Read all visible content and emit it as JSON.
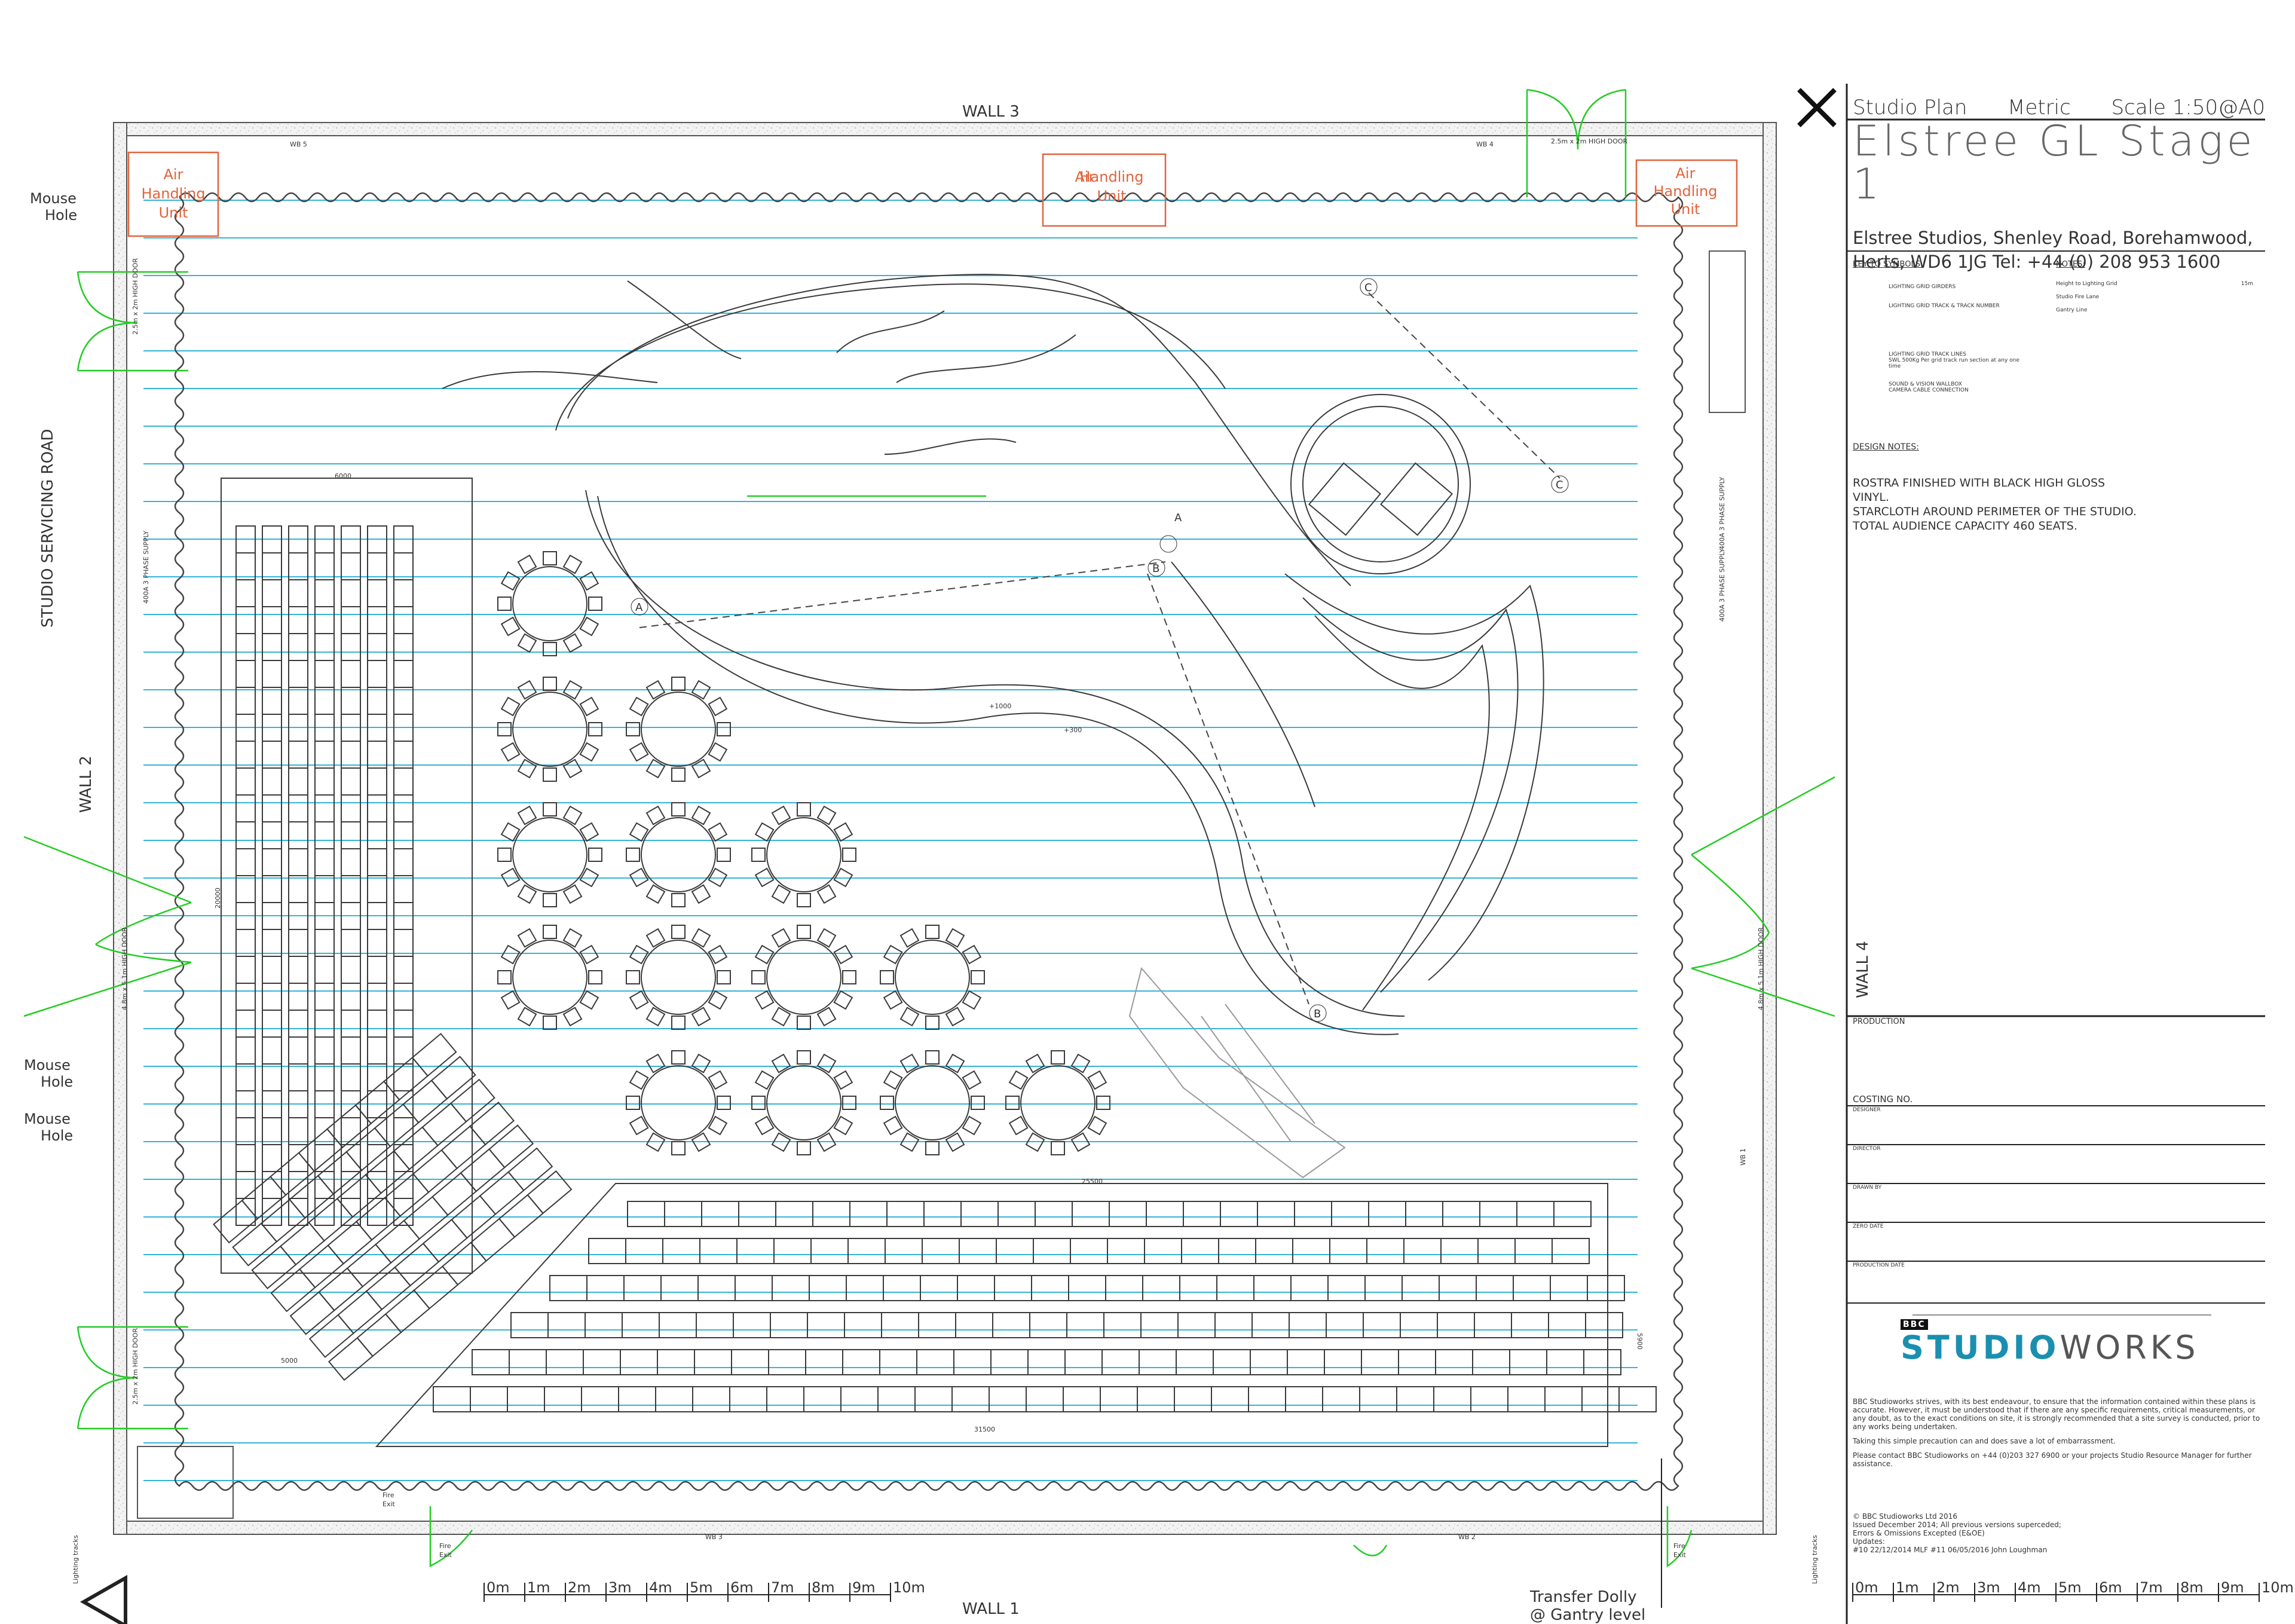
{
  "header": {
    "studio_plan": "Studio Plan",
    "metric": "Metric",
    "scale": "Scale 1:50@A0",
    "title": "Elstree GL Stage 1",
    "address_line1": "Elstree Studios, Shenley Road,   Borehamwood,",
    "address_line2": "Herts, WD6 1JG   Tel:   +44 (0) 208 953 1600"
  },
  "key": {
    "heading": "KEY TO SYMBOLS:",
    "items": [
      "LIGHTING GRID GIRDERS",
      "LIGHTING GRID TRACK & TRACK NUMBER",
      "LIGHTING GRID TRACK LINES",
      "SWL 500Kg Per grid track run section at any one time",
      "SOUND & VISION WALLBOX",
      "CAMERA CABLE CONNECTION"
    ]
  },
  "notes": {
    "heading": "NOTES:",
    "items": [
      {
        "label": "Height to Lighting Grid",
        "value": "15m"
      },
      {
        "label": "Studio Fire Lane",
        "value": ""
      },
      {
        "label": "Gantry Line",
        "value": ""
      }
    ]
  },
  "design_notes": {
    "heading": "DESIGN NOTES:",
    "lines": [
      "ROSTRA FINISHED WITH BLACK HIGH GLOSS",
      "VINYL.",
      "STARCLOTH AROUND PERIMETER OF THE STUDIO.",
      "TOTAL AUDIENCE CAPACITY 460 SEATS."
    ]
  },
  "form_fields": [
    "PRODUCTION",
    "COSTING NO.",
    "DESIGNER",
    "DIRECTOR",
    "DRAWN BY",
    "ZERO DATE",
    "PRODUCTION DATE"
  ],
  "brand": {
    "bbc": "BBC",
    "logo_a": "STUDIO",
    "logo_b": "WORKS",
    "color": "#1a8fb0"
  },
  "disclaimer": {
    "p1": "BBC Studioworks strives, with its best endeavour, to ensure that the information contained within these plans is accurate. However, it must be understood that if there are any specific requirements, critical measurements, or any doubt, as to the exact conditions on site, it is strongly recommended that a site survey is conducted, prior to any works being undertaken.",
    "p2": "Taking this simple precaution can and does save a lot of embarrassment.",
    "p3": "Please contact BBC Studioworks on +44 (0)203 327 6900 or your projects Studio Resource Manager for further assistance."
  },
  "footer": {
    "copyright": "© BBC Studioworks Ltd 2016",
    "issued": "Issued December 2014; All previous versions superceded;",
    "errors": "Errors & Omissions Excepted (E&OE)",
    "updates": "Updates:",
    "rev": "#10 22/12/2014 MLF #11 06/05/2016 John Loughman"
  },
  "walls": {
    "wall1": "WALL 1",
    "wall2": "WALL 2",
    "wall3": "WALL 3",
    "wall4": "WALL 4"
  },
  "labels": {
    "servicing_road": "STUDIO  SERVICING  ROAD",
    "ahu": [
      "Air",
      "Handling",
      "Unit"
    ],
    "mouse": [
      "Mouse",
      "Hole"
    ],
    "high_door_small": "2.5m x 2m HIGH DOOR",
    "high_door_large": "4.8m x 5.1m HIGH DOOR",
    "power": "400A 3 PHASE SUPPLY",
    "fire_exit": [
      "Fire",
      "Exit"
    ],
    "transfer_dolly": [
      "Transfer Dolly",
      "@ Gantry level"
    ],
    "lighting_tracks": "Lighting tracks",
    "wb": [
      "WB 5",
      "WB 4",
      "WB 1",
      "WB 3",
      "WB 2"
    ],
    "dims": [
      "6000",
      "20000",
      "25500",
      "31500",
      "5000",
      "5900",
      "+1000",
      "+300"
    ],
    "points": [
      "A",
      "B",
      "C"
    ]
  },
  "scale_bar": [
    "0m",
    "1m",
    "2m",
    "3m",
    "4m",
    "5m",
    "6m",
    "7m",
    "8m",
    "9m",
    "10m"
  ],
  "colors": {
    "grid": "#34b4d8",
    "door": "#22cc22",
    "ahu": "#e0643c",
    "line": "#3a3a3a",
    "wall_fill": "#efefef"
  }
}
